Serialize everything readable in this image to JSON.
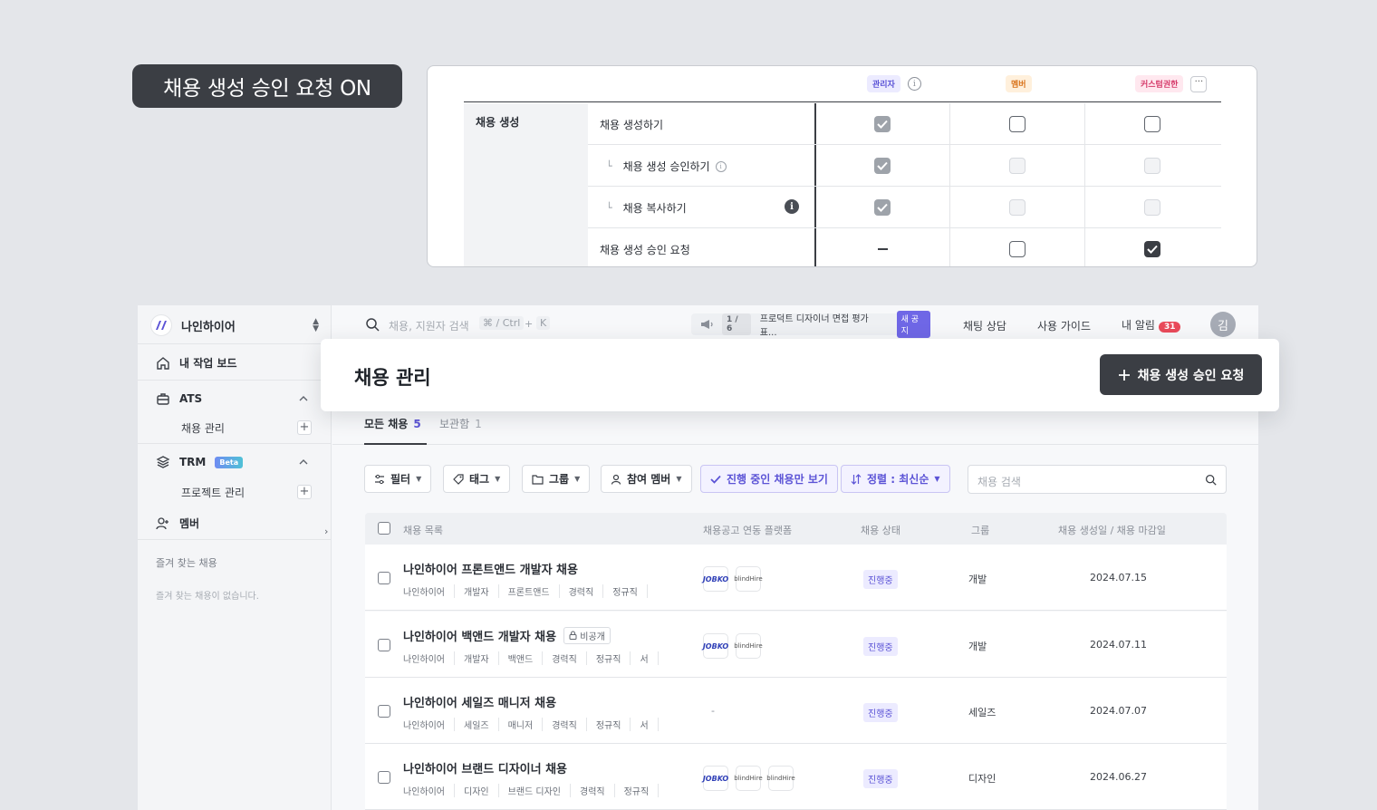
{
  "banner": {
    "title": "채용 생성 승인 요청 ON"
  },
  "permissions": {
    "roles": [
      {
        "label": "관리자",
        "color": "#5b53d6"
      },
      {
        "label": "멤버",
        "color": "#d9731b"
      },
      {
        "label": "커스텀권한",
        "color": "#d63a6a"
      }
    ],
    "more_label": "···",
    "group_label": "채용 생성",
    "rows": [
      {
        "label": "채용 생성하기",
        "states": [
          "checked-grey",
          "empty",
          "empty"
        ]
      },
      {
        "label": "채용 생성 승인하기",
        "sub": true,
        "states": [
          "checked-grey",
          "disabled",
          "disabled"
        ]
      },
      {
        "label": "채용 복사하기",
        "sub": true,
        "states": [
          "checked-grey",
          "disabled",
          "disabled"
        ]
      },
      {
        "label": "채용 생성 승인 요청",
        "states": [
          "dash",
          "empty",
          "checked-dark"
        ]
      }
    ]
  },
  "app": {
    "workspace": "나인하이어",
    "sidebar": {
      "home": "내 작업 보드",
      "ats": "ATS",
      "ats_sub": "채용 관리",
      "trm": "TRM",
      "trm_badge": "Beta",
      "trm_sub": "프로젝트 관리",
      "member": "멤버",
      "fav_title": "즐겨 찾는 채용",
      "fav_empty": "즐겨 찾는 채용이 없습니다."
    },
    "topbar": {
      "search_placeholder": "채용, 지원자 검색",
      "shortcut_1": "⌘ / Ctrl",
      "shortcut_plus": "+",
      "shortcut_2": "K",
      "notice_counter": "1 / 6",
      "notice_text": "프로덕트 디자이너 면접 평가표...",
      "notice_badge": "새 공지",
      "chat": "채팅 상담",
      "guide": "사용 가이드",
      "alarm": "내 알림",
      "alarm_count": "31",
      "avatar": "김"
    },
    "header": {
      "title": "채용 관리",
      "primary_button": "채용 생성 승인 요청"
    },
    "tabs": [
      {
        "label": "모든 채용",
        "count": "5"
      },
      {
        "label": "보관함",
        "count": "1"
      }
    ],
    "filters": {
      "filter": "필터",
      "tag": "태그",
      "group": "그룹",
      "member": "참여 멤버",
      "ongoing": "진행 중인 채용만 보기",
      "sort": "정렬 : 최신순",
      "search_placeholder": "채용 검색"
    },
    "table": {
      "headers": [
        "채용 목록",
        "채용공고 연동 플랫폼",
        "채용 상태",
        "그룹",
        "채용 생성일 / 채용 마감일"
      ],
      "rows": [
        {
          "title": "나인하이어 프론트앤드 개발자 채용",
          "private": "",
          "tags": [
            "나인하이어",
            "개발자",
            "프론트앤드",
            "경력직",
            "정규직"
          ],
          "platforms": [
            "JOBKO",
            "blindHire"
          ],
          "status": "진행중",
          "group": "개발",
          "date": "2024.07.15"
        },
        {
          "title": "나인하이어 백앤드 개발자 채용",
          "private": "비공개",
          "tags": [
            "나인하이어",
            "개발자",
            "백앤드",
            "경력직",
            "정규직",
            "서"
          ],
          "platforms": [
            "JOBKO",
            "blindHire"
          ],
          "status": "진행중",
          "group": "개발",
          "date": "2024.07.11"
        },
        {
          "title": "나인하이어 세일즈 매니저 채용",
          "private": "",
          "tags": [
            "나인하이어",
            "세일즈",
            "매니저",
            "경력직",
            "정규직",
            "서"
          ],
          "platforms": [],
          "no_platform": "-",
          "status": "진행중",
          "group": "세일즈",
          "date": "2024.07.07"
        },
        {
          "title": "나인하이어 브랜드 디자이너 채용",
          "private": "",
          "tags": [
            "나인하이어",
            "디자인",
            "브랜드 디자인",
            "경력직",
            "정규직"
          ],
          "platforms": [
            "JOBKO",
            "blindHire",
            "blindHire"
          ],
          "status": "진행중",
          "group": "디자인",
          "date": "2024.06.27"
        }
      ]
    }
  }
}
